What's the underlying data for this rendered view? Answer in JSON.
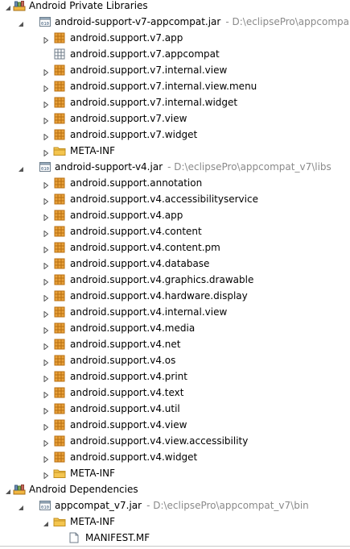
{
  "tree": [
    {
      "level": 0,
      "arrow": "expanded",
      "icon": "library-icon",
      "label": "Android Private Libraries",
      "path": ""
    },
    {
      "level": 1,
      "arrow": "expanded",
      "icon": "jar-icon",
      "label": "android-support-v7-appcompat.jar",
      "path": "- D:\\eclipsePro\\appcompa"
    },
    {
      "level": 2,
      "arrow": "collapsed",
      "icon": "package-icon",
      "label": "android.support.v7.app",
      "path": ""
    },
    {
      "level": 2,
      "arrow": "none",
      "icon": "empty-package-icon",
      "label": "android.support.v7.appcompat",
      "path": ""
    },
    {
      "level": 2,
      "arrow": "collapsed",
      "icon": "package-icon",
      "label": "android.support.v7.internal.view",
      "path": ""
    },
    {
      "level": 2,
      "arrow": "collapsed",
      "icon": "package-icon",
      "label": "android.support.v7.internal.view.menu",
      "path": ""
    },
    {
      "level": 2,
      "arrow": "collapsed",
      "icon": "package-icon",
      "label": "android.support.v7.internal.widget",
      "path": ""
    },
    {
      "level": 2,
      "arrow": "collapsed",
      "icon": "package-icon",
      "label": "android.support.v7.view",
      "path": ""
    },
    {
      "level": 2,
      "arrow": "collapsed",
      "icon": "package-icon",
      "label": "android.support.v7.widget",
      "path": ""
    },
    {
      "level": 2,
      "arrow": "collapsed",
      "icon": "folder-icon",
      "label": "META-INF",
      "path": ""
    },
    {
      "level": 1,
      "arrow": "expanded",
      "icon": "jar-icon",
      "label": "android-support-v4.jar",
      "path": "- D:\\eclipsePro\\appcompat_v7\\libs"
    },
    {
      "level": 2,
      "arrow": "collapsed",
      "icon": "package-icon",
      "label": "android.support.annotation",
      "path": ""
    },
    {
      "level": 2,
      "arrow": "collapsed",
      "icon": "package-icon",
      "label": "android.support.v4.accessibilityservice",
      "path": ""
    },
    {
      "level": 2,
      "arrow": "collapsed",
      "icon": "package-icon",
      "label": "android.support.v4.app",
      "path": ""
    },
    {
      "level": 2,
      "arrow": "collapsed",
      "icon": "package-icon",
      "label": "android.support.v4.content",
      "path": ""
    },
    {
      "level": 2,
      "arrow": "collapsed",
      "icon": "package-icon",
      "label": "android.support.v4.content.pm",
      "path": ""
    },
    {
      "level": 2,
      "arrow": "collapsed",
      "icon": "package-icon",
      "label": "android.support.v4.database",
      "path": ""
    },
    {
      "level": 2,
      "arrow": "collapsed",
      "icon": "package-icon",
      "label": "android.support.v4.graphics.drawable",
      "path": ""
    },
    {
      "level": 2,
      "arrow": "collapsed",
      "icon": "package-icon",
      "label": "android.support.v4.hardware.display",
      "path": ""
    },
    {
      "level": 2,
      "arrow": "collapsed",
      "icon": "package-icon",
      "label": "android.support.v4.internal.view",
      "path": ""
    },
    {
      "level": 2,
      "arrow": "collapsed",
      "icon": "package-icon",
      "label": "android.support.v4.media",
      "path": ""
    },
    {
      "level": 2,
      "arrow": "collapsed",
      "icon": "package-icon",
      "label": "android.support.v4.net",
      "path": ""
    },
    {
      "level": 2,
      "arrow": "collapsed",
      "icon": "package-icon",
      "label": "android.support.v4.os",
      "path": ""
    },
    {
      "level": 2,
      "arrow": "collapsed",
      "icon": "package-icon",
      "label": "android.support.v4.print",
      "path": ""
    },
    {
      "level": 2,
      "arrow": "collapsed",
      "icon": "package-icon",
      "label": "android.support.v4.text",
      "path": ""
    },
    {
      "level": 2,
      "arrow": "collapsed",
      "icon": "package-icon",
      "label": "android.support.v4.util",
      "path": ""
    },
    {
      "level": 2,
      "arrow": "collapsed",
      "icon": "package-icon",
      "label": "android.support.v4.view",
      "path": ""
    },
    {
      "level": 2,
      "arrow": "collapsed",
      "icon": "package-icon",
      "label": "android.support.v4.view.accessibility",
      "path": ""
    },
    {
      "level": 2,
      "arrow": "collapsed",
      "icon": "package-icon",
      "label": "android.support.v4.widget",
      "path": ""
    },
    {
      "level": 2,
      "arrow": "collapsed",
      "icon": "folder-icon",
      "label": "META-INF",
      "path": ""
    },
    {
      "level": 0,
      "arrow": "expanded",
      "icon": "library-icon",
      "label": "Android Dependencies",
      "path": ""
    },
    {
      "level": 1,
      "arrow": "expanded",
      "icon": "jar-icon",
      "label": "appcompat_v7.jar",
      "path": "- D:\\eclipsePro\\appcompat_v7\\bin"
    },
    {
      "level": 2,
      "arrow": "expanded",
      "icon": "folder-icon",
      "label": "META-INF",
      "path": ""
    },
    {
      "level": 3,
      "arrow": "none",
      "icon": "file-icon",
      "label": "MANIFEST.MF",
      "path": ""
    }
  ],
  "colors": {
    "path_text": "#8a8a8a",
    "package_fill": "#e9a23b",
    "package_stroke": "#b86f12",
    "folder_fill": "#f4c54f",
    "folder_stroke": "#c28f1f",
    "jar_stroke": "#6c7d8c",
    "arrow": "#555555"
  }
}
